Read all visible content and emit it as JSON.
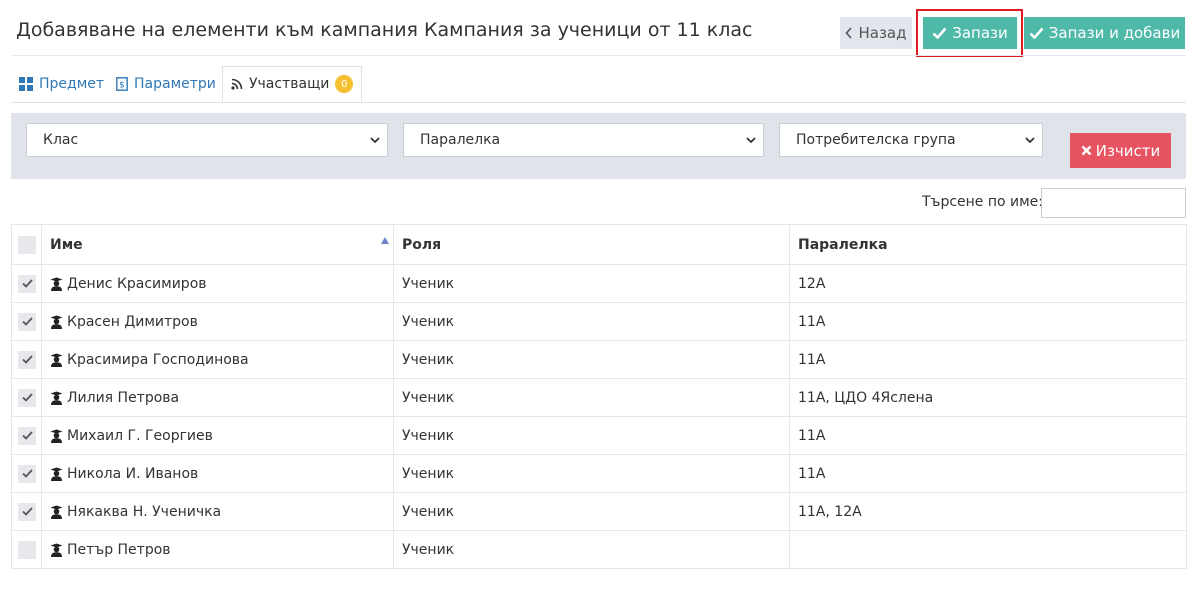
{
  "header": {
    "title": "Добавяване на елементи към кампания Кампания за ученици от 11 клас",
    "back_label": "Назад",
    "save_label": "Запази",
    "save_add_label": "Запази и добави"
  },
  "tabs": [
    {
      "label": "Предмет",
      "icon": "grid-icon"
    },
    {
      "label": "Параметри",
      "icon": "document-icon"
    },
    {
      "label": "Участващи",
      "icon": "rss-icon",
      "badge": "0",
      "active": true
    }
  ],
  "filters": {
    "class_placeholder": "Клас",
    "section_placeholder": "Паралелка",
    "group_placeholder": "Потребителска група",
    "clear_label": "Изчисти"
  },
  "search": {
    "label": "Търсене по име:",
    "value": ""
  },
  "table": {
    "headers": {
      "name": "Име",
      "role": "Роля",
      "section": "Паралелка"
    },
    "rows": [
      {
        "checked": true,
        "name": "Денис Красимиров",
        "role": "Ученик",
        "section": "12А"
      },
      {
        "checked": true,
        "name": "Красен Димитров",
        "role": "Ученик",
        "section": "11А"
      },
      {
        "checked": true,
        "name": "Красимира Господинова",
        "role": "Ученик",
        "section": "11А"
      },
      {
        "checked": true,
        "name": "Лилия Петрова",
        "role": "Ученик",
        "section": "11А, ЦДО 4Яслена"
      },
      {
        "checked": true,
        "name": "Михаил Г. Георгиев",
        "role": "Ученик",
        "section": "11А"
      },
      {
        "checked": true,
        "name": "Никола И. Иванов",
        "role": "Ученик",
        "section": "11А"
      },
      {
        "checked": true,
        "name": "Някаква Н. Ученичка",
        "role": "Ученик",
        "section": "11А, 12А"
      },
      {
        "checked": false,
        "name": "Петър Петров",
        "role": "Ученик",
        "section": ""
      }
    ]
  },
  "colors": {
    "accent": "#4fb9a8",
    "danger": "#e75461",
    "highlight_border": "#e21a22",
    "badge": "#f5c12e",
    "link": "#2f78b5"
  }
}
